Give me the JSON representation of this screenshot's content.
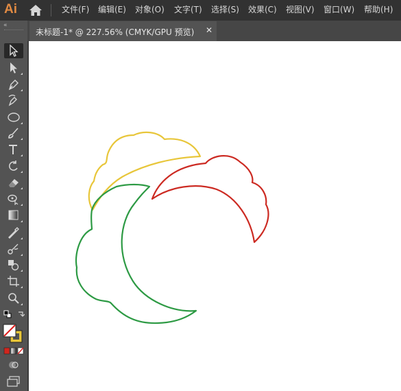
{
  "app": {
    "logo": "Ai"
  },
  "menu": {
    "items": [
      "文件(F)",
      "编辑(E)",
      "对象(O)",
      "文字(T)",
      "选择(S)",
      "效果(C)",
      "视图(V)",
      "窗口(W)",
      "帮助(H)"
    ]
  },
  "document": {
    "tab_title": "未标题-1* @ 227.56% (CMYK/GPU 预览)",
    "close_symbol": "✕"
  },
  "toolbar": {
    "collapse_symbol": "«",
    "tools": [
      "selection-tool",
      "direct-selection-tool",
      "pen-tool",
      "curvature-tool",
      "ellipse-tool",
      "paintbrush-tool",
      "type-tool",
      "rotate-tool",
      "eraser-tool",
      "puppet-warp-tool",
      "gradient-tool",
      "eyedropper-tool",
      "blend-tool",
      "shape-builder-tool",
      "artboard-tool",
      "zoom-tool"
    ],
    "active_tool": "selection-tool"
  },
  "artwork": {
    "colors": {
      "yellow": "#e8c63a",
      "red": "#cc2a22",
      "green": "#2d9a44"
    }
  }
}
